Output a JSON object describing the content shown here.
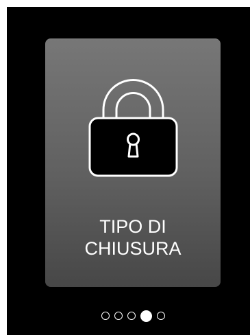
{
  "card": {
    "title_line1": "TIPO DI",
    "title_line2": "CHIUSURA",
    "icon": "padlock-icon"
  },
  "pager": {
    "total": 5,
    "active_index": 3
  },
  "colors": {
    "background": "#000000",
    "card_top": "#777777",
    "card_bottom": "#474747",
    "foreground": "#ffffff"
  }
}
